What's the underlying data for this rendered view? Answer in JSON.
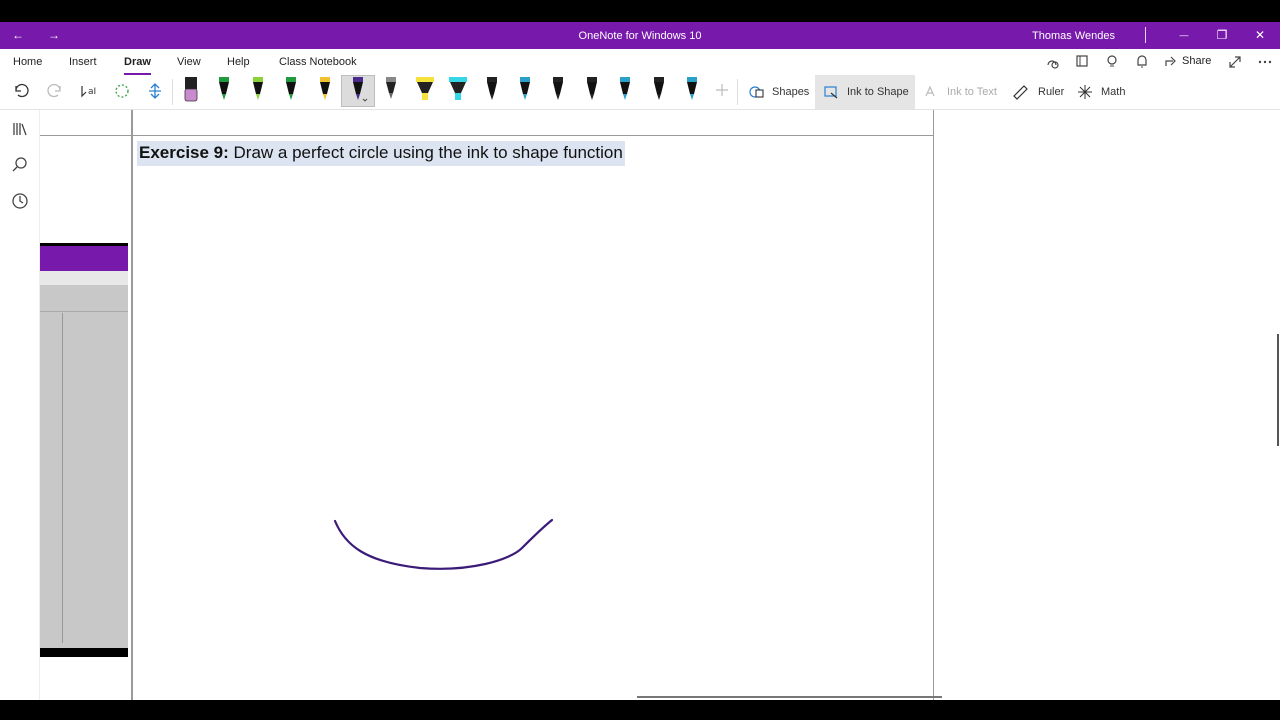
{
  "window": {
    "title": "OneNote for Windows 10",
    "user": "Thomas Wendes",
    "back_glyph": "←",
    "forward_glyph": "→",
    "minimize_glyph": "—",
    "restore_glyph": "❐",
    "close_glyph": "✕"
  },
  "menu": {
    "items": [
      "Home",
      "Insert",
      "Draw",
      "View",
      "Help",
      "Class Notebook"
    ],
    "active": "Draw",
    "share_label": "Share"
  },
  "draw_toolbar": {
    "shapes_label": "Shapes",
    "ink_to_shape_label": "Ink to Shape",
    "ink_to_text_label": "Ink to Text",
    "ruler_label": "Ruler",
    "math_label": "Math",
    "pens": [
      {
        "type": "eraser",
        "color": "#c98bd0"
      },
      {
        "type": "pen",
        "color": "#1f9a3c"
      },
      {
        "type": "pen",
        "color": "#8ad23a"
      },
      {
        "type": "pen",
        "color": "#1f9a3c"
      },
      {
        "type": "pen",
        "color": "#f2c12e"
      },
      {
        "type": "pen",
        "color": "#4a2a8a",
        "selected": true
      },
      {
        "type": "pencil",
        "color": "#888888"
      },
      {
        "type": "highlighter",
        "color": "#f5e23a"
      },
      {
        "type": "highlighter",
        "color": "#35d6e6"
      },
      {
        "type": "pen",
        "color": "#222222"
      },
      {
        "type": "pen",
        "color": "#2aa0c8"
      },
      {
        "type": "pen",
        "color": "#222222"
      },
      {
        "type": "pen",
        "color": "#222222"
      },
      {
        "type": "pen",
        "color": "#2aa0c8"
      },
      {
        "type": "pen",
        "color": "#222222"
      },
      {
        "type": "pen",
        "color": "#2aa0c8"
      }
    ]
  },
  "page": {
    "exercise_label": "Exercise 9:",
    "exercise_text": " Draw a perfect circle using the ink to shape function",
    "ink_color": "#3b1a78"
  },
  "colors": {
    "accent": "#7719aa",
    "highlight": "#dbe4f0"
  }
}
